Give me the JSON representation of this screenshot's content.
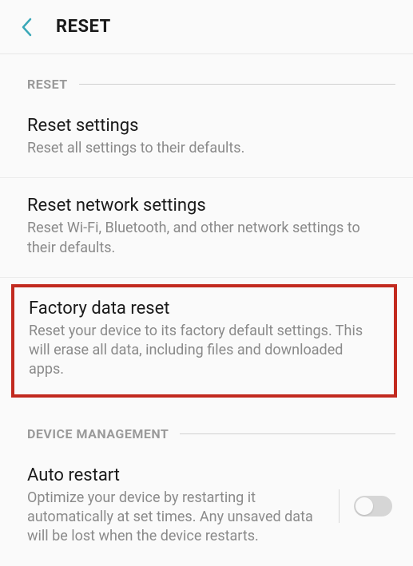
{
  "header": {
    "title": "RESET"
  },
  "sections": {
    "reset": {
      "label": "RESET",
      "items": [
        {
          "title": "Reset settings",
          "desc": "Reset all settings to their defaults."
        },
        {
          "title": "Reset network settings",
          "desc": "Reset Wi-Fi, Bluetooth, and other network settings to their defaults."
        },
        {
          "title": "Factory data reset",
          "desc": "Reset your device to its factory default settings. This will erase all data, including files and downloaded apps."
        }
      ]
    },
    "device_management": {
      "label": "DEVICE MANAGEMENT",
      "items": [
        {
          "title": "Auto restart",
          "desc": "Optimize your device by restarting it automatically at set times. Any unsaved data will be lost when the device restarts.",
          "toggle": false
        }
      ]
    }
  }
}
